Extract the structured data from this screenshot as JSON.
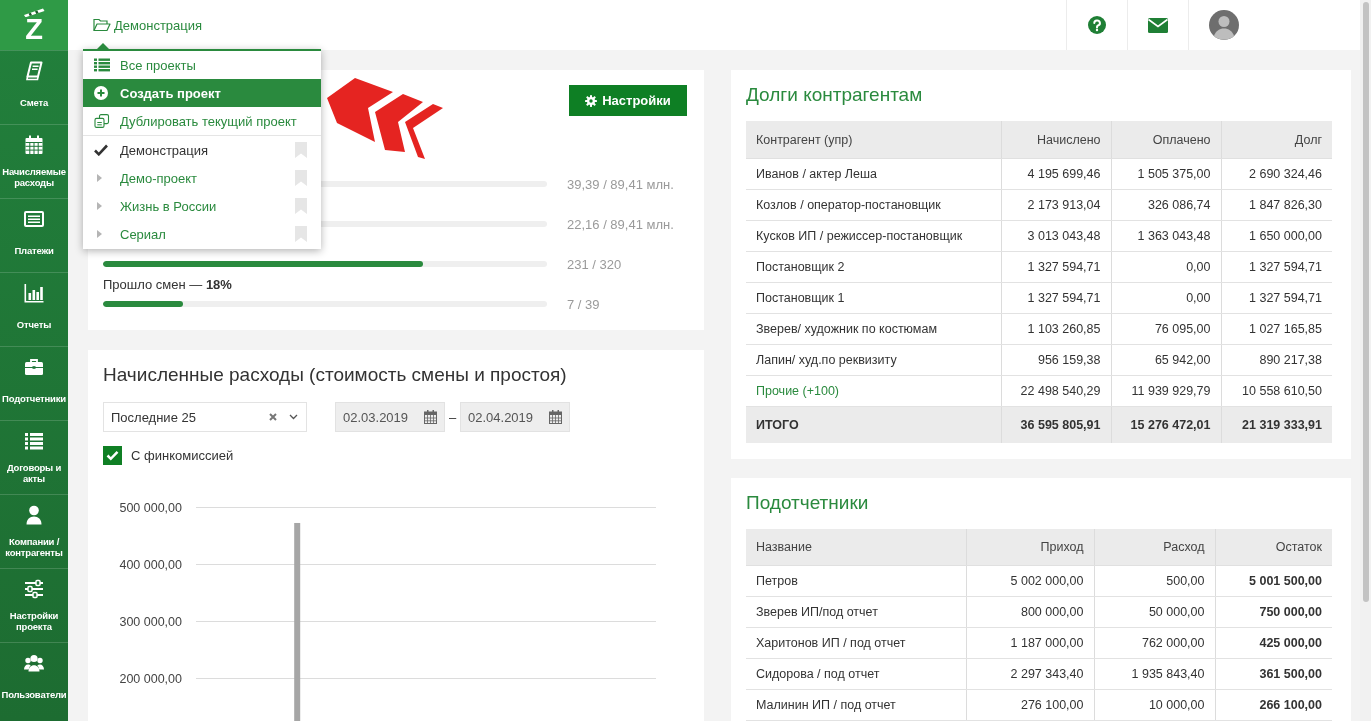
{
  "sidebar": {
    "logo": "Z",
    "items": [
      {
        "label": "Смета"
      },
      {
        "label": "Начисляемые расходы"
      },
      {
        "label": "Платежи"
      },
      {
        "label": "Отчеты"
      },
      {
        "label": "Подотчетники"
      },
      {
        "label": "Договоры и акты"
      },
      {
        "label": "Компании / контрагенты"
      },
      {
        "label": "Настройки проекта"
      },
      {
        "label": "Пользователи"
      }
    ]
  },
  "topbar": {
    "breadcrumb": "Демонстрация"
  },
  "project_menu": {
    "actions": [
      {
        "label": "Все проекты",
        "selected": false
      },
      {
        "label": "Создать проект",
        "selected": true
      },
      {
        "label": "Дублировать текущий проект",
        "selected": false
      }
    ],
    "projects": [
      {
        "label": "Демонстрация",
        "checked": true
      },
      {
        "label": "Демо-проект",
        "checked": false
      },
      {
        "label": "Жизнь в России",
        "checked": false
      },
      {
        "label": "Сериал",
        "checked": false
      }
    ]
  },
  "budget_card": {
    "settings_button": "Настройки",
    "progress": [
      {
        "reading": "39,39 / 89,41 млн."
      },
      {
        "reading": "22,16 / 89,41 млн."
      },
      {
        "level": 0.72,
        "reading": "231 / 320"
      },
      {
        "label": "Прошло смен — **18%**",
        "level": 0.18,
        "reading": "7 / 39"
      }
    ]
  },
  "accruals_card": {
    "title": "Начисленные расходы (стоимость смены и простоя)",
    "period_select": {
      "value": "Последние 25"
    },
    "date_from": "02.03.2019",
    "date_separator": "–",
    "date_to": "02.04.2019",
    "commission": {
      "label": "С финкомиссией",
      "checked": true
    },
    "chart_data": {
      "type": "bar",
      "grid": true,
      "values": [
        null,
        null,
        null,
        null,
        null,
        472000,
        null,
        null,
        null,
        null,
        null,
        null,
        null,
        null,
        null,
        null,
        null,
        null,
        null,
        null,
        null,
        null,
        null,
        null,
        null
      ],
      "ylim": [
        125000,
        500000
      ],
      "yticks": [
        {
          "value": 200000,
          "label": "200 000,00"
        },
        {
          "value": 300000,
          "label": "300 000,00"
        },
        {
          "value": 400000,
          "label": "400 000,00"
        },
        {
          "value": 500000,
          "label": "500 000,00"
        }
      ]
    }
  },
  "debts_card": {
    "title": "Долги контрагентам",
    "columns": [
      "Контрагент (упр)",
      "Начислено",
      "Оплачено",
      "Долг"
    ],
    "rows": [
      {
        "kind": "plain",
        "cells": [
          "Иванов / актер Леша",
          "4 195 699,46",
          "1 505 375,00",
          "2 690 324,46"
        ]
      },
      {
        "kind": "plain",
        "cells": [
          "Козлов / оператор-постановщик",
          "2 173 913,04",
          "326 086,74",
          "1 847 826,30"
        ]
      },
      {
        "kind": "plain",
        "cells": [
          "Кусков ИП / режиссер-постановщик",
          "3 013 043,48",
          "1 363 043,48",
          "1 650 000,00"
        ]
      },
      {
        "kind": "plain",
        "cells": [
          "Постановщик 2",
          "1 327 594,71",
          "0,00",
          "1 327 594,71"
        ]
      },
      {
        "kind": "plain",
        "cells": [
          "Постановщик 1",
          "1 327 594,71",
          "0,00",
          "1 327 594,71"
        ]
      },
      {
        "kind": "plain",
        "cells": [
          "Зверев/ художник по костюмам",
          "1 103 260,85",
          "76 095,00",
          "1 027 165,85"
        ]
      },
      {
        "kind": "plain",
        "cells": [
          "Лапин/ худ.по реквизиту",
          "956 159,38",
          "65 942,00",
          "890 217,38"
        ]
      },
      {
        "kind": "link",
        "cells": [
          "Прочие (+100)",
          "22 498 540,29",
          "11 939 929,79",
          "10 558 610,50"
        ]
      }
    ],
    "total": [
      "ИТОГО",
      "36 595 805,91",
      "15 276 472,01",
      "21 319 333,91"
    ]
  },
  "accountables_card": {
    "title": "Подотчетники",
    "columns": [
      "Название",
      "Приход",
      "Расход",
      "Остаток"
    ],
    "rows": [
      [
        "Петров",
        "5 002 000,00",
        "500,00",
        "5 001 500,00"
      ],
      [
        "Зверев ИП/под отчет",
        "800 000,00",
        "50 000,00",
        "750 000,00"
      ],
      [
        "Харитонов ИП / под отчет",
        "1 187 000,00",
        "762 000,00",
        "425 000,00"
      ],
      [
        "Сидорова / под отчет",
        "2 297 343,40",
        "1 935 843,40",
        "361 500,00"
      ],
      [
        "Малинин ИП / под отчет",
        "276 100,00",
        "10 000,00",
        "266 100,00"
      ]
    ]
  }
}
